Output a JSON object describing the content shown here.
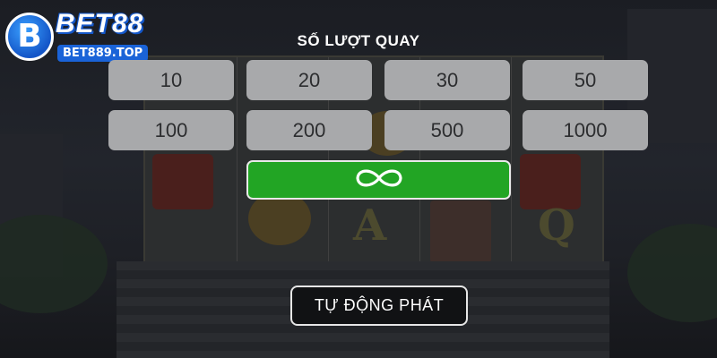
{
  "logo": {
    "badge_letter": "B",
    "name": "BET88",
    "domain": "BET889.TOP"
  },
  "panel": {
    "title": "SỐ LƯỢT QUAY",
    "spin_options": [
      "10",
      "20",
      "30",
      "50",
      "100",
      "200",
      "500",
      "1000"
    ],
    "infinity_icon": "infinity-icon",
    "autoplay_label": "TỰ ĐỘNG PHÁT"
  },
  "colors": {
    "option_button": "#a8a9ab",
    "infinity_button": "#22a524",
    "autoplay_button": "#111214"
  }
}
